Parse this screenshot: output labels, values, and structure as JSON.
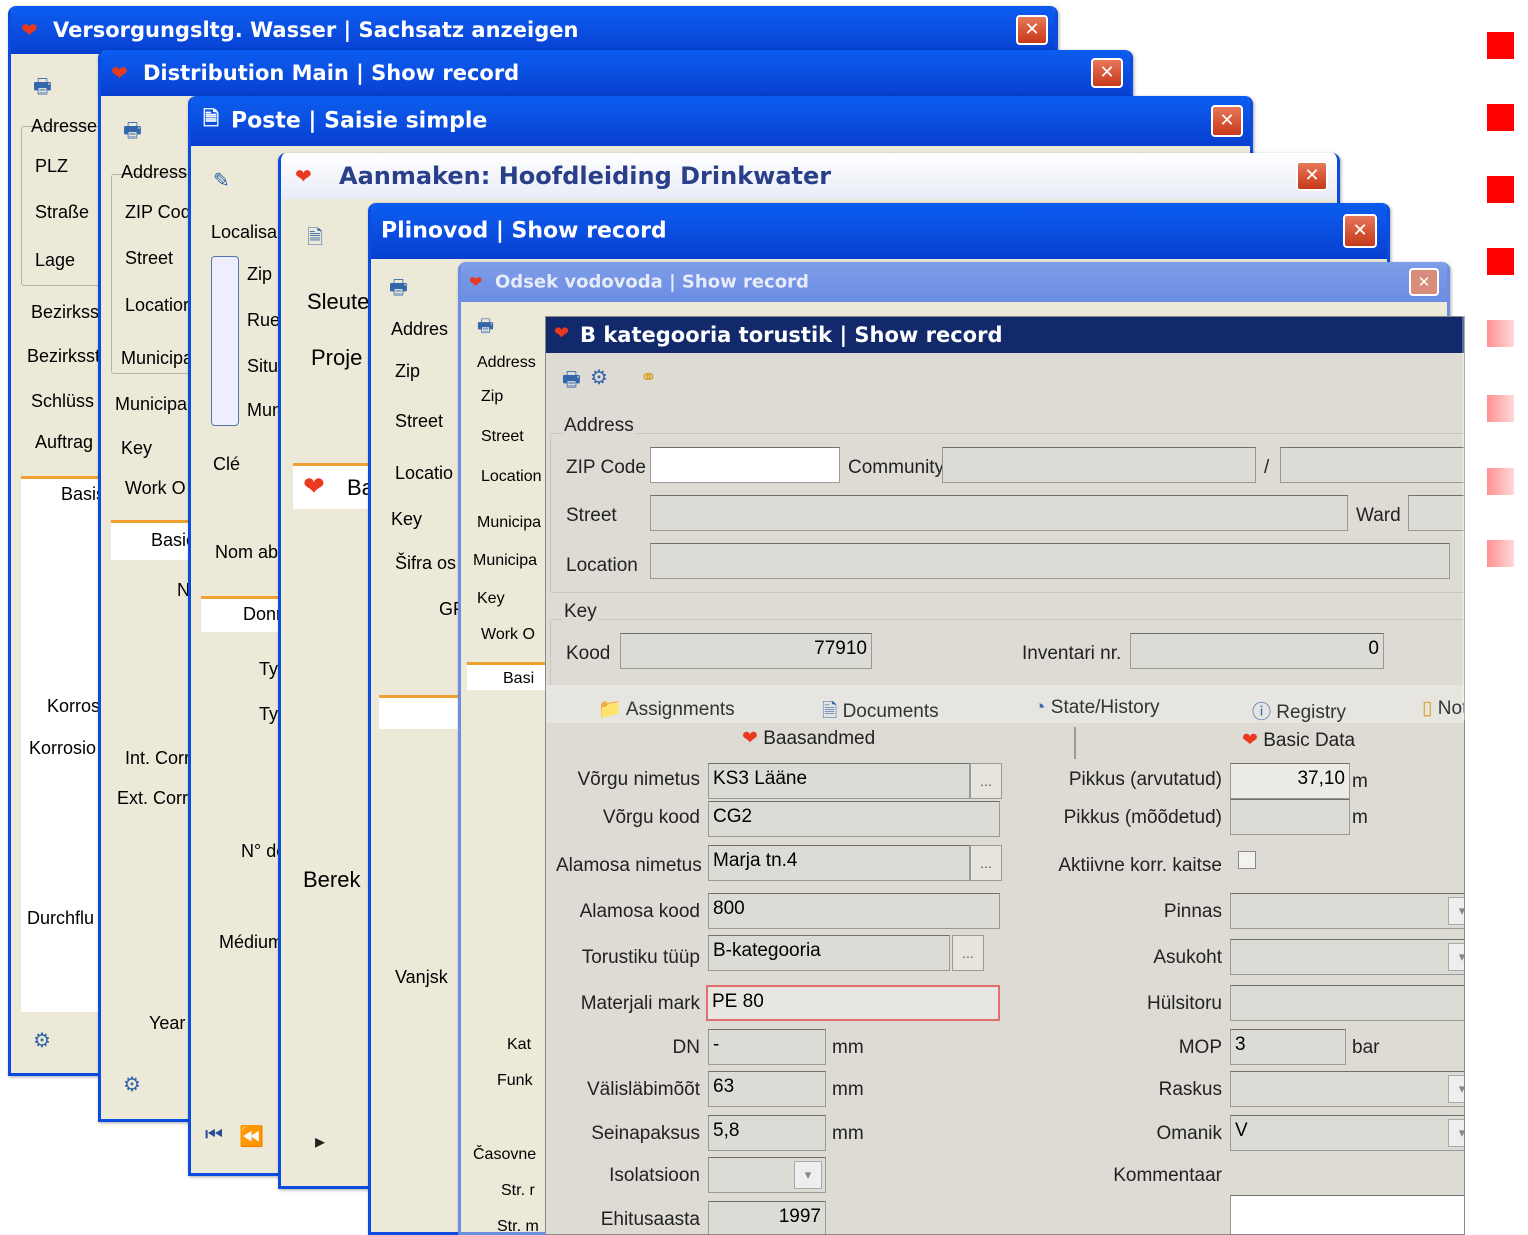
{
  "windows": [
    {
      "title": "Versorgungsltg. Wasser | Sachsatz anzeigen",
      "labels": [
        "Adresse",
        "PLZ",
        "Straße",
        "Lage",
        "Bezirkss",
        "Bezirksst",
        "Schlüss",
        "Auftrag",
        "Basis",
        "Korros",
        "Korrosio",
        "Durchflu"
      ]
    },
    {
      "title": "Distribution Main | Show record",
      "labels": [
        "Address",
        "ZIP Cod",
        "Street",
        "Locatior",
        "Municipa",
        "Municipal",
        "Key",
        "Work O",
        "Basic",
        "N",
        "Int. Corr",
        "Ext. Corr",
        "Year"
      ]
    },
    {
      "title": "Poste | Saisie simple",
      "labels": [
        "Localisa",
        "Zip",
        "Rue",
        "Situ",
        "Mun",
        "Clé",
        "Nom abr",
        "Donr",
        "Ty",
        "Ty",
        "N° de",
        "Médium"
      ]
    },
    {
      "title": "Aanmaken: Hoofdleiding Drinkwater",
      "labels": [
        "Sleute",
        "Proje",
        "Ba",
        "Berek"
      ]
    },
    {
      "title": "Plinovod | Show record",
      "labels": [
        "Addres",
        "Zip",
        "Street",
        "Locatio",
        "Key",
        "Šifra os",
        "GF",
        "Vanjsk"
      ]
    },
    {
      "title": "Odsek vodovoda | Show record",
      "labels": [
        "Address",
        "Zip",
        "Street",
        "Location",
        "Municipa",
        "Municipa",
        "Key",
        "Work O",
        "Basi",
        "Kat",
        "Funk",
        "Časovne",
        "Str. r",
        "Str. m"
      ]
    }
  ],
  "front": {
    "title": "B kategooria torustik | Show record",
    "address_group": "Address",
    "zip_label": "ZIP Code",
    "community_label": "Community",
    "slash": "/",
    "street_label": "Street",
    "ward_label": "Ward",
    "location_label": "Location",
    "key_group": "Key",
    "kood_label": "Kood",
    "kood_value": "77910",
    "inventari_label": "Inventari nr.",
    "inventari_value": "0",
    "tabs": [
      "Assignments",
      "Documents",
      "State/History",
      "Registry",
      "Notes"
    ],
    "sub_left": "Baasandmed",
    "sub_right": "Basic Data",
    "left": {
      "vorgu_nimetus_l": "Võrgu nimetus",
      "vorgu_nimetus_v": "KS3 Lääne",
      "vorgu_kood_l": "Võrgu kood",
      "vorgu_kood_v": "CG2",
      "alamosa_nimetus_l": "Alamosa nimetus",
      "alamosa_nimetus_v": "Marja tn.4",
      "alamosa_kood_l": "Alamosa kood",
      "alamosa_kood_v": "800",
      "torustiku_tuup_l": "Torustiku tüüp",
      "torustiku_tuup_v": "B-kategooria",
      "materjal_l": "Materjali mark",
      "materjal_v": "PE 80",
      "dn_l": "DN",
      "dn_v": "-",
      "dn_u": "mm",
      "valis_l": "Välisläbimõõt",
      "valis_v": "63",
      "valis_u": "mm",
      "sein_l": "Seinapaksus",
      "sein_v": "5,8",
      "sein_u": "mm",
      "isol_l": "Isolatsioon",
      "ehit_l": "Ehitusaasta",
      "ehit_v": "1997"
    },
    "right": {
      "pikkus_a_l": "Pikkus (arvutatud)",
      "pikkus_a_v": "37,10",
      "pikkus_a_u": "m",
      "pikkus_m_l": "Pikkus (mõõdetud)",
      "pikkus_m_u": "m",
      "aktiivne_l": "Aktiivne korr. kaitse",
      "pinnas_l": "Pinnas",
      "asukoht_l": "Asukoht",
      "hulsitoru_l": "Hülsitoru",
      "mop_l": "MOP",
      "mop_v": "3",
      "mop_u": "bar",
      "raskus_l": "Raskus",
      "omanik_l": "Omanik",
      "omanik_v": "V",
      "kommentaar_l": "Kommentaar"
    }
  },
  "colors": {
    "xp_blue": "#0a4be0",
    "front_title": "#122a6b",
    "bullet": "#ff0000",
    "required_border": "#e07070"
  }
}
